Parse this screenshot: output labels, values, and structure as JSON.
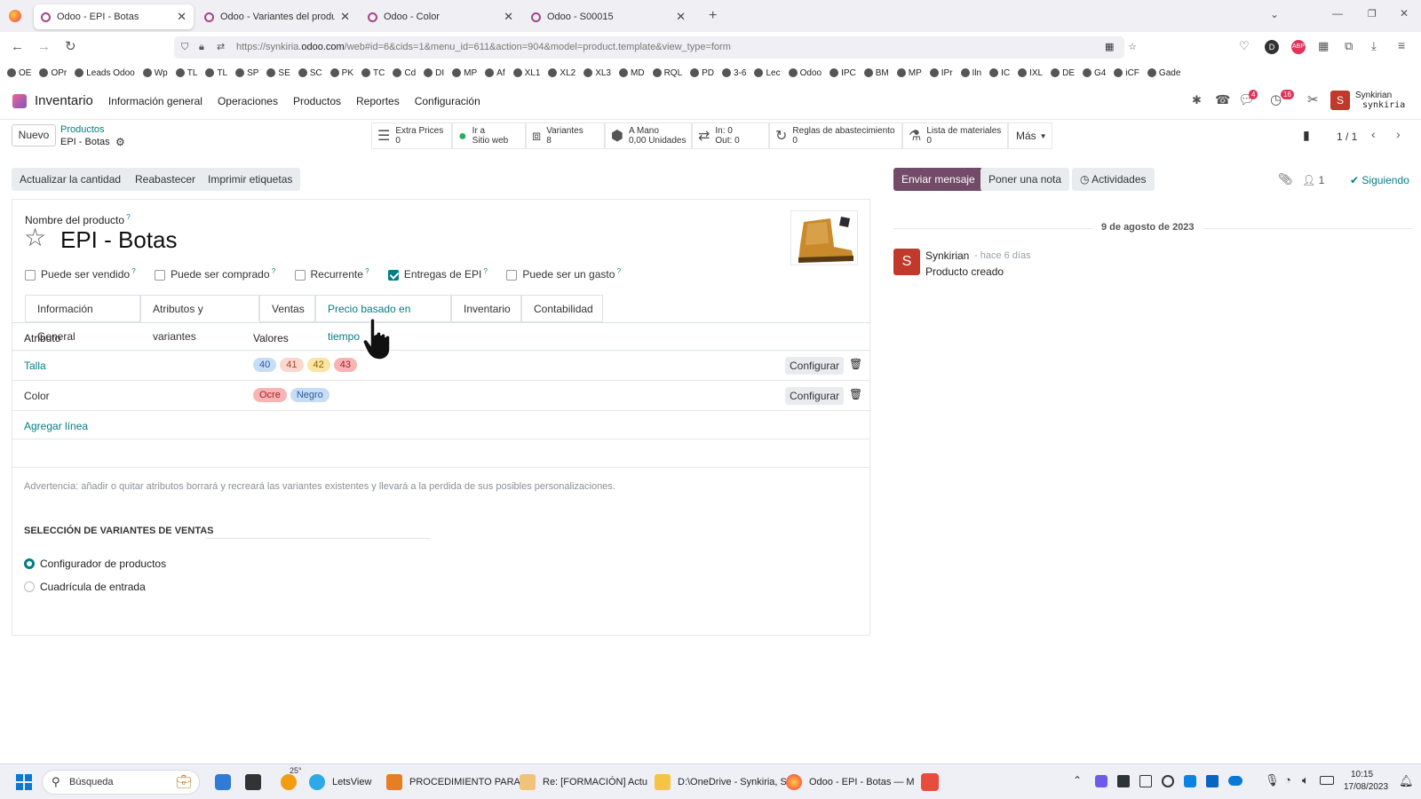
{
  "browser": {
    "tabs": [
      {
        "title": "Odoo - EPI - Botas",
        "active": true
      },
      {
        "title": "Odoo - Variantes del producto",
        "active": false
      },
      {
        "title": "Odoo - Color",
        "active": false
      },
      {
        "title": "Odoo - S00015",
        "active": false
      }
    ],
    "url_prefix": "https://synkiria.",
    "url_domain": "odoo.com",
    "url_rest": "/web#id=6&cids=1&menu_id=611&action=904&model=product.template&view_type=form",
    "bookmarks": [
      "OE",
      "OPr",
      "Leads Odoo",
      "Wp",
      "TL",
      "TL",
      "SP",
      "SE",
      "SC",
      "PK",
      "TC",
      "Cd",
      "DI",
      "MP",
      "Af",
      "XL1",
      "XL2",
      "XL3",
      "MD",
      "RQL",
      "PD",
      "3-6",
      "Lec",
      "Odoo",
      "IPC",
      "BM",
      "MP",
      "IPr",
      "Iln",
      "IC",
      "IXL",
      "DE",
      "G4",
      "iCF",
      "Gade"
    ]
  },
  "odoo_nav": {
    "app": "Inventario",
    "menus": [
      "Información general",
      "Operaciones",
      "Productos",
      "Reportes",
      "Configuración"
    ],
    "chat_count": "4",
    "activity_count": "16",
    "user_name": "Synkirian",
    "user_db": "synkiria",
    "user_initial": "S"
  },
  "control_panel": {
    "new_label": "Nuevo",
    "breadcrumb_parent": "Productos",
    "breadcrumb_current": "EPI - Botas",
    "smart_buttons": [
      {
        "l1": "Extra Prices",
        "l2": "0"
      },
      {
        "l1": "Ir a",
        "l2": "Sitio web"
      },
      {
        "l1": "Variantes",
        "l2": "8"
      },
      {
        "l1": "A Mano",
        "l2": "0,00 Unidades"
      },
      {
        "l1": "In: 0",
        "l2": "Out: 0"
      },
      {
        "l1": "Reglas de abastecimiento",
        "l2": "0"
      },
      {
        "l1": "Lista de materiales",
        "l2": "0"
      }
    ],
    "more_label": "Más",
    "pager": "1 / 1"
  },
  "header_buttons": [
    "Actualizar la cantidad",
    "Reabastecer",
    "Imprimir etiquetas"
  ],
  "form": {
    "name_label": "Nombre del producto",
    "name": "EPI - Botas",
    "checkboxes": [
      {
        "label": "Puede ser vendido",
        "checked": false
      },
      {
        "label": "Puede ser comprado",
        "checked": false
      },
      {
        "label": "Recurrente",
        "checked": false
      },
      {
        "label": "Entregas de EPI",
        "checked": true
      },
      {
        "label": "Puede ser un gasto",
        "checked": false
      }
    ],
    "tabs": [
      "Información General",
      "Atributos y variantes",
      "Ventas",
      "Precio basado en tiempo",
      "Inventario",
      "Contabilidad"
    ],
    "active_tab": "Atributos y variantes",
    "col_attribute": "Atributo",
    "col_values": "Valores",
    "rows": [
      {
        "attribute": "Talla",
        "values": [
          "40",
          "41",
          "42",
          "43"
        ]
      },
      {
        "attribute": "Color",
        "values": [
          "Ocre",
          "Negro"
        ]
      }
    ],
    "configure_label": "Configurar",
    "add_line": "Agregar línea",
    "warning": "Advertencia: añadir o quitar atributos borrará y recreará las variantes existentes y llevará a la perdida de sus posibles personalizaciones.",
    "section_title": "SELECCIÓN DE VARIANTES DE VENTAS",
    "radio_options": [
      {
        "label": "Configurador de productos",
        "selected": true
      },
      {
        "label": "Cuadrícula de entrada",
        "selected": false
      }
    ]
  },
  "chatter": {
    "send_message": "Enviar mensaje",
    "log_note": "Poner una nota",
    "activities": "Actividades",
    "followers_count": "1",
    "following": "Siguiendo",
    "date": "9 de agosto de 2023",
    "author": "Synkirian",
    "author_initial": "S",
    "time": "- hace 6 días",
    "body": "Producto creado"
  },
  "taskbar": {
    "search_placeholder": "Búsqueda",
    "temperature": "25°",
    "apps": [
      "LetsView",
      "PROCEDIMIENTO PARA",
      "Re: [FORMACIÓN] Actu",
      "D:\\OneDrive - Synkiria, S",
      "Odoo - EPI - Botas — M"
    ],
    "time": "10:15",
    "date": "17/08/2023"
  },
  "colors": {
    "odoo_primary": "#714b67",
    "teal": "#017e84",
    "badge_40": "#c7dcf5",
    "badge_41": "#f9d7cc",
    "badge_42": "#fce5a2",
    "badge_43": "#f8b4b4",
    "badge_ocre": "#f8b4b4",
    "badge_negro": "#c7dcf5"
  }
}
